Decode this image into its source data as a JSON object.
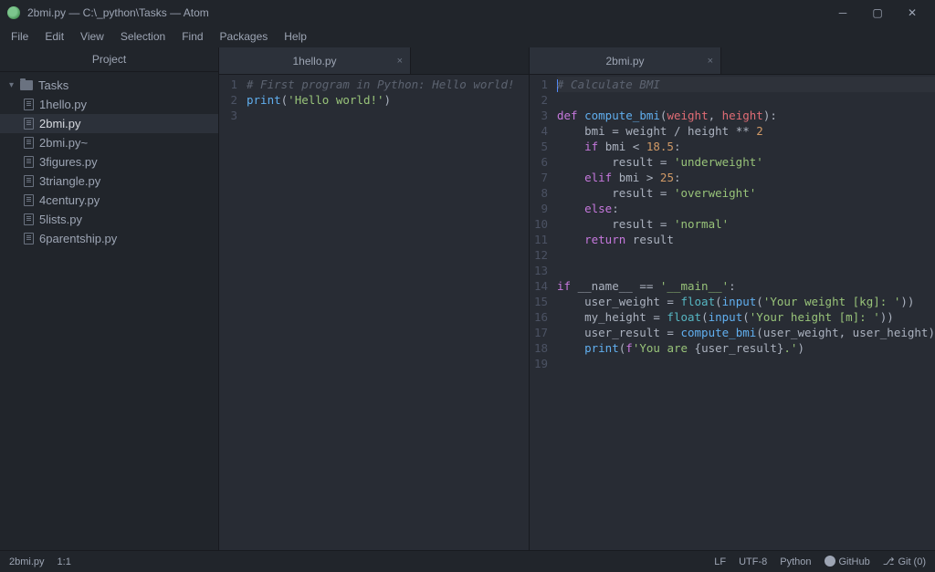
{
  "window": {
    "title": "2bmi.py — C:\\_python\\Tasks — Atom"
  },
  "menu": [
    "File",
    "Edit",
    "View",
    "Selection",
    "Find",
    "Packages",
    "Help"
  ],
  "sidebar": {
    "title": "Project",
    "root": "Tasks",
    "files": [
      "1hello.py",
      "2bmi.py",
      "2bmi.py~",
      "3figures.py",
      "3triangle.py",
      "4century.py",
      "5lists.py",
      "6parentship.py"
    ],
    "selected": "2bmi.py"
  },
  "panes": [
    {
      "tab": "1hello.py",
      "lines": [
        [
          {
            "cls": "c-comment",
            "t": "# First program in Python: Hello world!"
          }
        ],
        [
          {
            "cls": "c-fn",
            "t": "print"
          },
          {
            "cls": "c-op",
            "t": "("
          },
          {
            "cls": "c-str",
            "t": "'Hello world!'"
          },
          {
            "cls": "c-op",
            "t": ")"
          }
        ],
        []
      ]
    },
    {
      "tab": "2bmi.py",
      "lines": [
        [
          {
            "cls": "cursor",
            "t": ""
          },
          {
            "cls": "c-comment",
            "t": "# Calculate BMI"
          }
        ],
        [],
        [
          {
            "cls": "c-kw",
            "t": "def "
          },
          {
            "cls": "c-fn",
            "t": "compute_bmi"
          },
          {
            "cls": "c-op",
            "t": "("
          },
          {
            "cls": "c-var",
            "t": "weight"
          },
          {
            "cls": "c-op",
            "t": ", "
          },
          {
            "cls": "c-var",
            "t": "height"
          },
          {
            "cls": "c-op",
            "t": "):"
          }
        ],
        [
          {
            "cls": "",
            "t": "    bmi "
          },
          {
            "cls": "c-op",
            "t": "= "
          },
          {
            "cls": "",
            "t": "weight "
          },
          {
            "cls": "c-op",
            "t": "/ "
          },
          {
            "cls": "",
            "t": "height "
          },
          {
            "cls": "c-op",
            "t": "** "
          },
          {
            "cls": "c-num",
            "t": "2"
          }
        ],
        [
          {
            "cls": "",
            "t": "    "
          },
          {
            "cls": "c-kw",
            "t": "if "
          },
          {
            "cls": "",
            "t": "bmi "
          },
          {
            "cls": "c-op",
            "t": "< "
          },
          {
            "cls": "c-num",
            "t": "18.5"
          },
          {
            "cls": "c-op",
            "t": ":"
          }
        ],
        [
          {
            "cls": "",
            "t": "        result "
          },
          {
            "cls": "c-op",
            "t": "= "
          },
          {
            "cls": "c-str",
            "t": "'underweight'"
          }
        ],
        [
          {
            "cls": "",
            "t": "    "
          },
          {
            "cls": "c-kw",
            "t": "elif "
          },
          {
            "cls": "",
            "t": "bmi "
          },
          {
            "cls": "c-op",
            "t": "> "
          },
          {
            "cls": "c-num",
            "t": "25"
          },
          {
            "cls": "c-op",
            "t": ":"
          }
        ],
        [
          {
            "cls": "",
            "t": "        result "
          },
          {
            "cls": "c-op",
            "t": "= "
          },
          {
            "cls": "c-str",
            "t": "'overweight'"
          }
        ],
        [
          {
            "cls": "",
            "t": "    "
          },
          {
            "cls": "c-kw",
            "t": "else"
          },
          {
            "cls": "c-op",
            "t": ":"
          }
        ],
        [
          {
            "cls": "",
            "t": "        result "
          },
          {
            "cls": "c-op",
            "t": "= "
          },
          {
            "cls": "c-str",
            "t": "'normal'"
          }
        ],
        [
          {
            "cls": "",
            "t": "    "
          },
          {
            "cls": "c-kw",
            "t": "return "
          },
          {
            "cls": "",
            "t": "result"
          }
        ],
        [],
        [],
        [
          {
            "cls": "c-kw",
            "t": "if "
          },
          {
            "cls": "",
            "t": "__name__ "
          },
          {
            "cls": "c-op",
            "t": "== "
          },
          {
            "cls": "c-str",
            "t": "'__main__'"
          },
          {
            "cls": "c-op",
            "t": ":"
          }
        ],
        [
          {
            "cls": "",
            "t": "    user_weight "
          },
          {
            "cls": "c-op",
            "t": "= "
          },
          {
            "cls": "c-bi",
            "t": "float"
          },
          {
            "cls": "c-op",
            "t": "("
          },
          {
            "cls": "c-fn",
            "t": "input"
          },
          {
            "cls": "c-op",
            "t": "("
          },
          {
            "cls": "c-str",
            "t": "'Your weight [kg]: '"
          },
          {
            "cls": "c-op",
            "t": "))"
          }
        ],
        [
          {
            "cls": "",
            "t": "    my_height "
          },
          {
            "cls": "c-op",
            "t": "= "
          },
          {
            "cls": "c-bi",
            "t": "float"
          },
          {
            "cls": "c-op",
            "t": "("
          },
          {
            "cls": "c-fn",
            "t": "input"
          },
          {
            "cls": "c-op",
            "t": "("
          },
          {
            "cls": "c-str",
            "t": "'Your height [m]: '"
          },
          {
            "cls": "c-op",
            "t": "))"
          }
        ],
        [
          {
            "cls": "",
            "t": "    user_result "
          },
          {
            "cls": "c-op",
            "t": "= "
          },
          {
            "cls": "c-fn",
            "t": "compute_bmi"
          },
          {
            "cls": "c-op",
            "t": "("
          },
          {
            "cls": "",
            "t": "user_weight"
          },
          {
            "cls": "c-op",
            "t": ", "
          },
          {
            "cls": "",
            "t": "user_height"
          },
          {
            "cls": "c-op",
            "t": ")"
          }
        ],
        [
          {
            "cls": "",
            "t": "    "
          },
          {
            "cls": "c-fn",
            "t": "print"
          },
          {
            "cls": "c-op",
            "t": "("
          },
          {
            "cls": "c-kw",
            "t": "f"
          },
          {
            "cls": "c-str",
            "t": "'You are "
          },
          {
            "cls": "c-op",
            "t": "{"
          },
          {
            "cls": "",
            "t": "user_result"
          },
          {
            "cls": "c-op",
            "t": "}"
          },
          {
            "cls": "c-str",
            "t": ".'"
          },
          {
            "cls": "c-op",
            "t": ")"
          }
        ],
        []
      ]
    }
  ],
  "status": {
    "file": "2bmi.py",
    "position": "1:1",
    "lineEnding": "LF",
    "encoding": "UTF-8",
    "grammar": "Python",
    "github": "GitHub",
    "git": "Git (0)"
  }
}
